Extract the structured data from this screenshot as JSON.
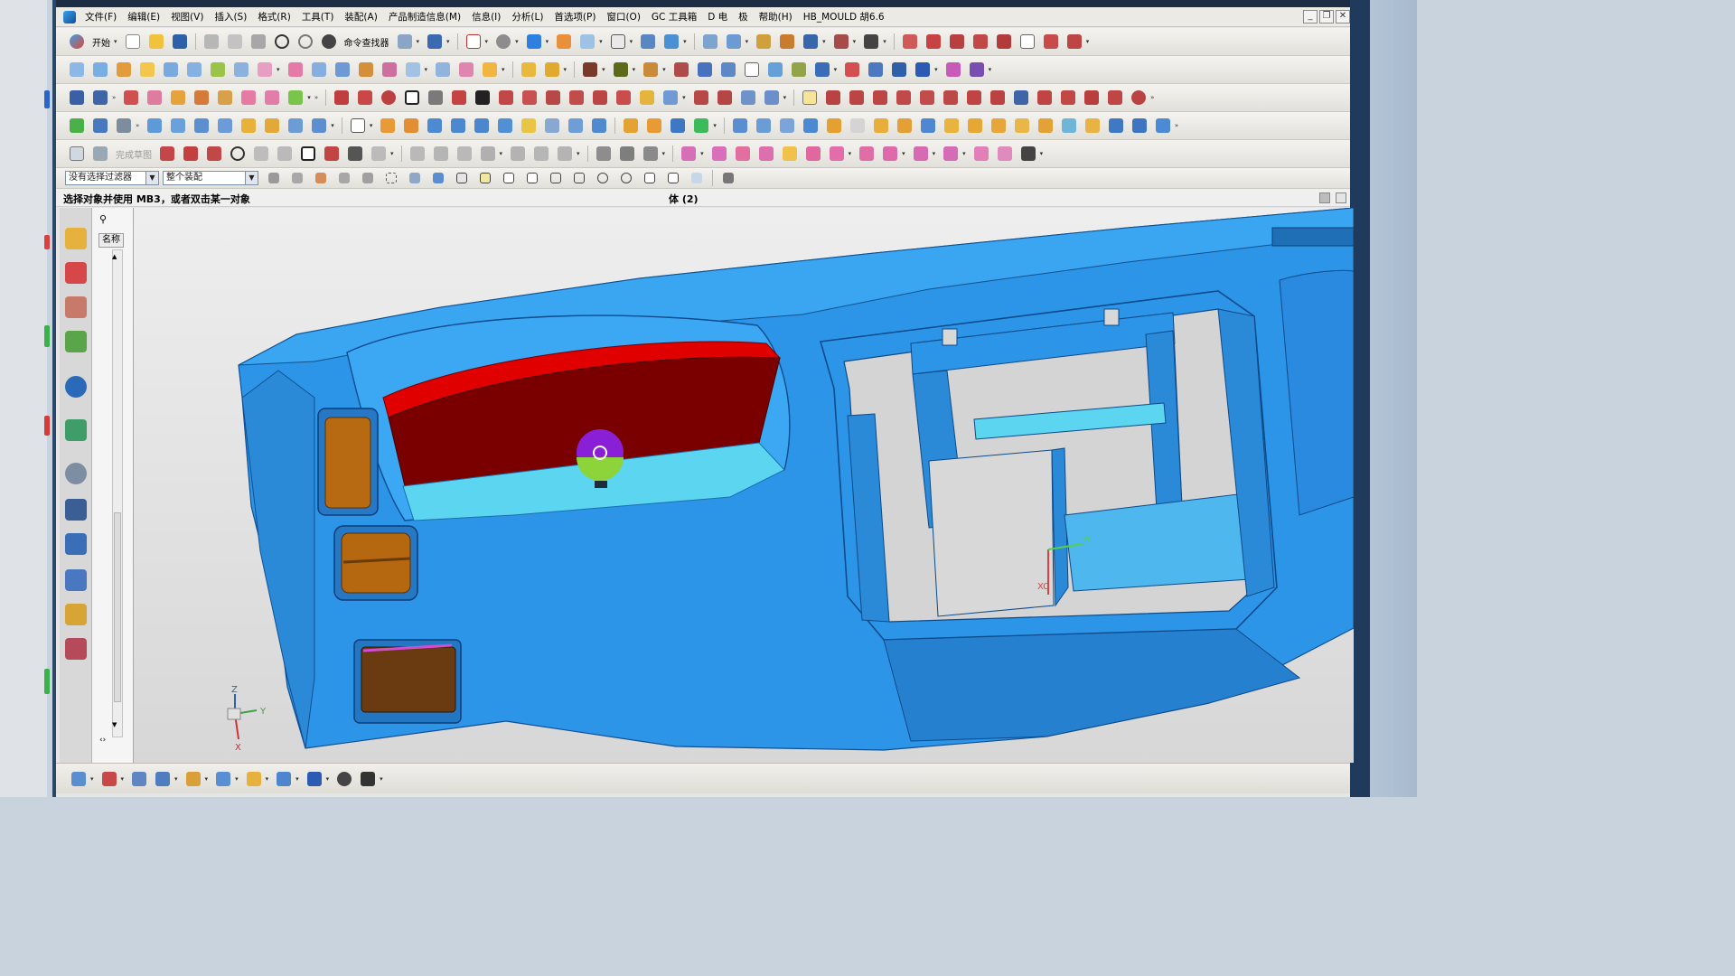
{
  "menubar": {
    "items": [
      "文件(F)",
      "编辑(E)",
      "视图(V)",
      "插入(S)",
      "格式(R)",
      "工具(T)",
      "装配(A)",
      "产品制造信息(M)",
      "信息(I)",
      "分析(L)",
      "首选项(P)",
      "窗口(O)",
      "GC 工具箱",
      "D 电",
      "极",
      "帮助(H)",
      "HB_MOULD 胡6.6"
    ]
  },
  "toolbar1": {
    "start_label": "开始",
    "command_finder_label": "命令查找器"
  },
  "sketch_toolbar": {
    "finish_sketch_label": "完成草图"
  },
  "selection_bar": {
    "filter_value": "没有选择过滤器",
    "scope_value": "整个装配"
  },
  "status": {
    "prompt": "选择对象并使用 MB3，或者双击某一对象",
    "center": "体 (2)"
  },
  "navigator": {
    "column_header": "名称"
  },
  "triad": {
    "x": "X",
    "y": "Y",
    "z": "Z"
  },
  "wcs": {
    "xc": "XC",
    "yc": "YC"
  },
  "colors": {
    "part_blue": "#2d95e8",
    "part_cyan": "#5cd6f0",
    "highlight_red": "#b50000",
    "highlight_dark": "#7a0000",
    "bronze": "#b86a12",
    "brown": "#6a3a10"
  }
}
